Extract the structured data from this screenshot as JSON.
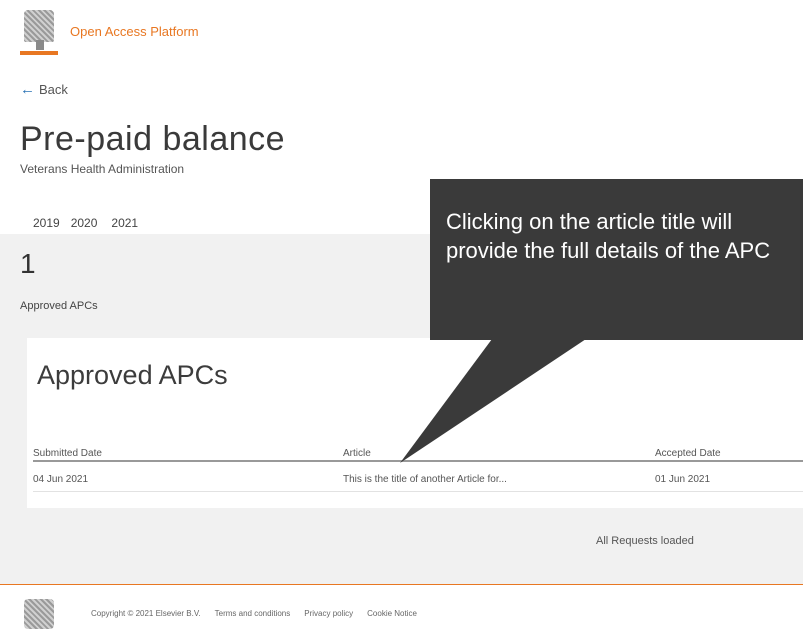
{
  "header": {
    "brand": "Open Access Platform",
    "logo_icon": "elsevier-tree-logo"
  },
  "nav": {
    "back_label": "Back"
  },
  "page": {
    "title": "Pre-paid balance",
    "subtitle": "Veterans Health Administration"
  },
  "year_tabs": {
    "items": [
      "2019",
      "2020",
      "2021"
    ],
    "active": "2021"
  },
  "summary": {
    "count": "1",
    "label": "Approved APCs"
  },
  "approved_table": {
    "title": "Approved APCs",
    "columns": [
      "Submitted Date",
      "Article",
      "Accepted Date"
    ],
    "rows": [
      {
        "submitted": "04 Jun 2021",
        "article": "This is the title of another Article for...",
        "accepted": "01 Jun 2021"
      }
    ]
  },
  "status": {
    "loaded_text": "All Requests loaded"
  },
  "footer": {
    "copyright": "Copyright © 2021 Elsevier B.V.",
    "links": [
      "Terms and conditions",
      "Privacy policy",
      "Cookie Notice"
    ]
  },
  "callout": {
    "text": "Clicking on the article title will provide the full details of the APC",
    "background": "#3a3a3a"
  },
  "colors": {
    "accent": "#e87722",
    "link": "#2a72b5",
    "band": "#f1f1f1"
  }
}
